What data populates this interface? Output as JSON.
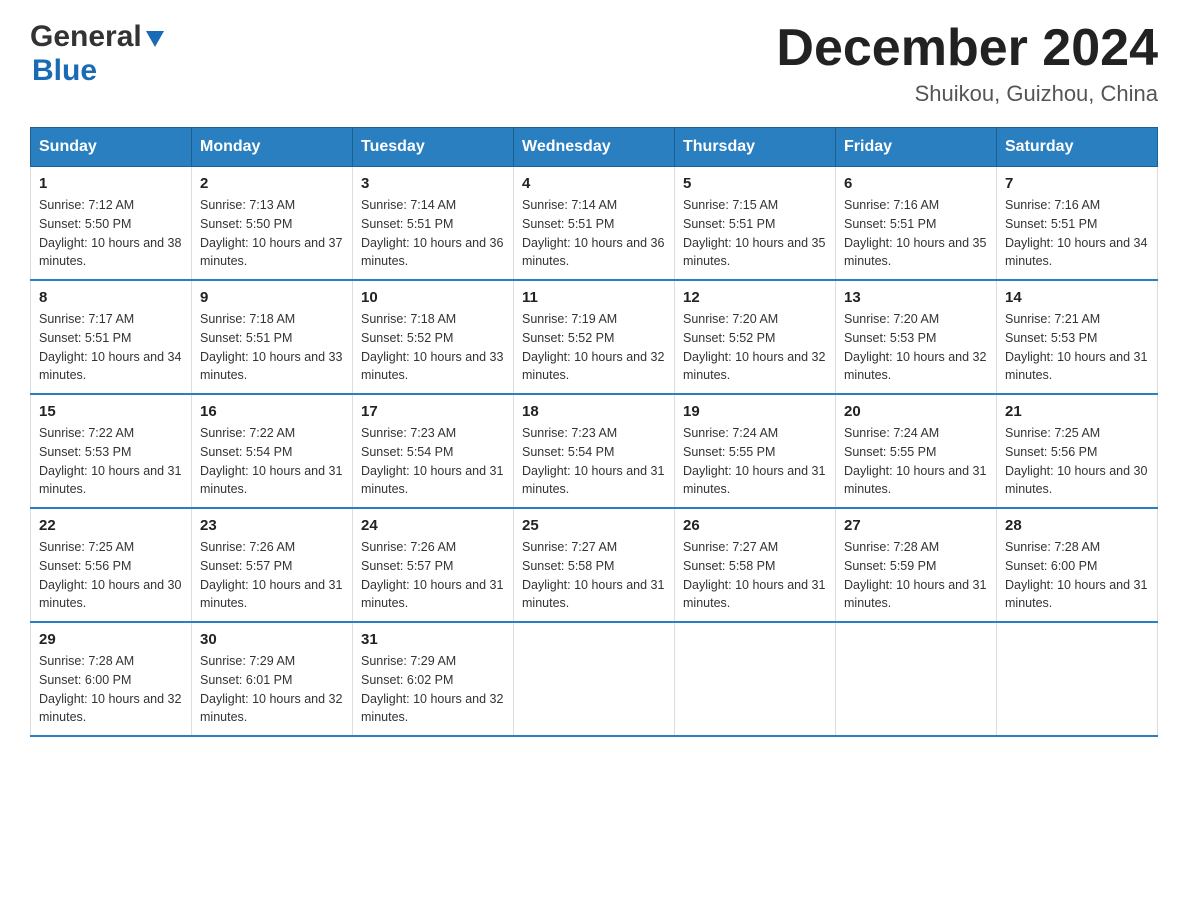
{
  "header": {
    "logo_general": "General",
    "logo_blue": "Blue",
    "month_title": "December 2024",
    "location": "Shuikou, Guizhou, China"
  },
  "days_of_week": [
    "Sunday",
    "Monday",
    "Tuesday",
    "Wednesday",
    "Thursday",
    "Friday",
    "Saturday"
  ],
  "weeks": [
    [
      {
        "day": "1",
        "sunrise": "7:12 AM",
        "sunset": "5:50 PM",
        "daylight": "10 hours and 38 minutes."
      },
      {
        "day": "2",
        "sunrise": "7:13 AM",
        "sunset": "5:50 PM",
        "daylight": "10 hours and 37 minutes."
      },
      {
        "day": "3",
        "sunrise": "7:14 AM",
        "sunset": "5:51 PM",
        "daylight": "10 hours and 36 minutes."
      },
      {
        "day": "4",
        "sunrise": "7:14 AM",
        "sunset": "5:51 PM",
        "daylight": "10 hours and 36 minutes."
      },
      {
        "day": "5",
        "sunrise": "7:15 AM",
        "sunset": "5:51 PM",
        "daylight": "10 hours and 35 minutes."
      },
      {
        "day": "6",
        "sunrise": "7:16 AM",
        "sunset": "5:51 PM",
        "daylight": "10 hours and 35 minutes."
      },
      {
        "day": "7",
        "sunrise": "7:16 AM",
        "sunset": "5:51 PM",
        "daylight": "10 hours and 34 minutes."
      }
    ],
    [
      {
        "day": "8",
        "sunrise": "7:17 AM",
        "sunset": "5:51 PM",
        "daylight": "10 hours and 34 minutes."
      },
      {
        "day": "9",
        "sunrise": "7:18 AM",
        "sunset": "5:51 PM",
        "daylight": "10 hours and 33 minutes."
      },
      {
        "day": "10",
        "sunrise": "7:18 AM",
        "sunset": "5:52 PM",
        "daylight": "10 hours and 33 minutes."
      },
      {
        "day": "11",
        "sunrise": "7:19 AM",
        "sunset": "5:52 PM",
        "daylight": "10 hours and 32 minutes."
      },
      {
        "day": "12",
        "sunrise": "7:20 AM",
        "sunset": "5:52 PM",
        "daylight": "10 hours and 32 minutes."
      },
      {
        "day": "13",
        "sunrise": "7:20 AM",
        "sunset": "5:53 PM",
        "daylight": "10 hours and 32 minutes."
      },
      {
        "day": "14",
        "sunrise": "7:21 AM",
        "sunset": "5:53 PM",
        "daylight": "10 hours and 31 minutes."
      }
    ],
    [
      {
        "day": "15",
        "sunrise": "7:22 AM",
        "sunset": "5:53 PM",
        "daylight": "10 hours and 31 minutes."
      },
      {
        "day": "16",
        "sunrise": "7:22 AM",
        "sunset": "5:54 PM",
        "daylight": "10 hours and 31 minutes."
      },
      {
        "day": "17",
        "sunrise": "7:23 AM",
        "sunset": "5:54 PM",
        "daylight": "10 hours and 31 minutes."
      },
      {
        "day": "18",
        "sunrise": "7:23 AM",
        "sunset": "5:54 PM",
        "daylight": "10 hours and 31 minutes."
      },
      {
        "day": "19",
        "sunrise": "7:24 AM",
        "sunset": "5:55 PM",
        "daylight": "10 hours and 31 minutes."
      },
      {
        "day": "20",
        "sunrise": "7:24 AM",
        "sunset": "5:55 PM",
        "daylight": "10 hours and 31 minutes."
      },
      {
        "day": "21",
        "sunrise": "7:25 AM",
        "sunset": "5:56 PM",
        "daylight": "10 hours and 30 minutes."
      }
    ],
    [
      {
        "day": "22",
        "sunrise": "7:25 AM",
        "sunset": "5:56 PM",
        "daylight": "10 hours and 30 minutes."
      },
      {
        "day": "23",
        "sunrise": "7:26 AM",
        "sunset": "5:57 PM",
        "daylight": "10 hours and 31 minutes."
      },
      {
        "day": "24",
        "sunrise": "7:26 AM",
        "sunset": "5:57 PM",
        "daylight": "10 hours and 31 minutes."
      },
      {
        "day": "25",
        "sunrise": "7:27 AM",
        "sunset": "5:58 PM",
        "daylight": "10 hours and 31 minutes."
      },
      {
        "day": "26",
        "sunrise": "7:27 AM",
        "sunset": "5:58 PM",
        "daylight": "10 hours and 31 minutes."
      },
      {
        "day": "27",
        "sunrise": "7:28 AM",
        "sunset": "5:59 PM",
        "daylight": "10 hours and 31 minutes."
      },
      {
        "day": "28",
        "sunrise": "7:28 AM",
        "sunset": "6:00 PM",
        "daylight": "10 hours and 31 minutes."
      }
    ],
    [
      {
        "day": "29",
        "sunrise": "7:28 AM",
        "sunset": "6:00 PM",
        "daylight": "10 hours and 32 minutes."
      },
      {
        "day": "30",
        "sunrise": "7:29 AM",
        "sunset": "6:01 PM",
        "daylight": "10 hours and 32 minutes."
      },
      {
        "day": "31",
        "sunrise": "7:29 AM",
        "sunset": "6:02 PM",
        "daylight": "10 hours and 32 minutes."
      },
      null,
      null,
      null,
      null
    ]
  ]
}
